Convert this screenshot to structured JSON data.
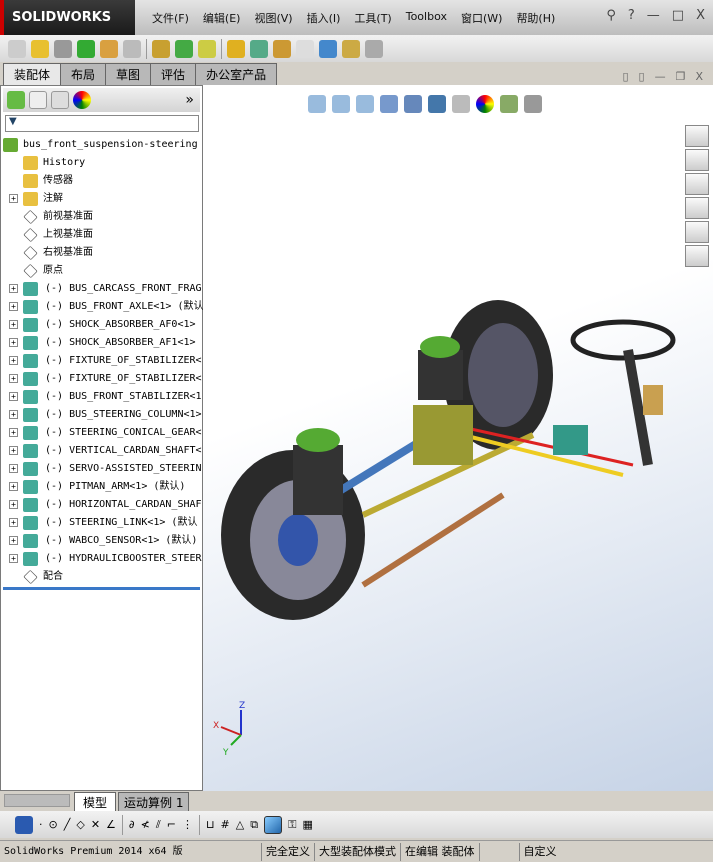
{
  "app": {
    "logo": "SOLIDWORKS"
  },
  "menu": [
    "文件(F)",
    "编辑(E)",
    "视图(V)",
    "插入(I)",
    "工具(T)",
    "Toolbox",
    "窗口(W)",
    "帮助(H)"
  ],
  "window_controls": {
    "help": "?",
    "minimize": "—",
    "restore": "□",
    "close": "X"
  },
  "tabs": [
    {
      "label": "装配体",
      "active": true
    },
    {
      "label": "布局"
    },
    {
      "label": "草图"
    },
    {
      "label": "评估"
    },
    {
      "label": "办公室产品"
    }
  ],
  "panel": {
    "expand": "»",
    "filter_icon": "filter-icon"
  },
  "tree": {
    "root": "bus_front_suspension-steering",
    "features": [
      {
        "label": "History",
        "icon": "history-folder-icon",
        "expand": false
      },
      {
        "label": "传感器",
        "icon": "sensor-folder-icon",
        "expand": false
      },
      {
        "label": "注解",
        "icon": "annotation-icon",
        "expand": true
      },
      {
        "label": "前视基准面",
        "icon": "plane-icon",
        "expand": false
      },
      {
        "label": "上视基准面",
        "icon": "plane-icon",
        "expand": false
      },
      {
        "label": "右视基准面",
        "icon": "plane-icon",
        "expand": false
      },
      {
        "label": "原点",
        "icon": "origin-icon",
        "expand": false
      }
    ],
    "components": [
      "(-) BUS_CARCASS_FRONT_FRAG",
      "(-) BUS_FRONT_AXLE<1> (默认",
      "(-) SHOCK_ABSORBER_AF0<1>",
      "(-) SHOCK_ABSORBER_AF1<1>",
      "(-) FIXTURE_OF_STABILIZER<",
      "(-) FIXTURE_OF_STABILIZER<",
      "(-) BUS_FRONT_STABILIZER<1",
      "(-) BUS_STEERING_COLUMN<1>",
      "(-) STEERING_CONICAL_GEAR<",
      "(-) VERTICAL_CARDAN_SHAFT<",
      "(-) SERVO-ASSISTED_STEERIN",
      "(-) PITMAN_ARM<1> (默认)",
      "(-) HORIZONTAL_CARDAN_SHAF",
      "(-) STEERING_LINK<1> (默认",
      "(-) WABCO_SENSOR<1> (默认)",
      "(-) HYDRAULICBOOSTER_STEER"
    ],
    "mates": "配合"
  },
  "triad": {
    "x": "X",
    "y": "Y",
    "z": "Z"
  },
  "bottom_tabs": [
    {
      "label": "模型",
      "active": true
    },
    {
      "label": "运动算例 1"
    }
  ],
  "status": {
    "product": "SolidWorks Premium 2014 x64 版",
    "state": "完全定义",
    "mode": "大型装配体模式",
    "editing": "在编辑 装配体",
    "custom": "自定义"
  },
  "colors": {
    "accent": "#3a78c8",
    "title_dark": "#1a1a1a"
  }
}
